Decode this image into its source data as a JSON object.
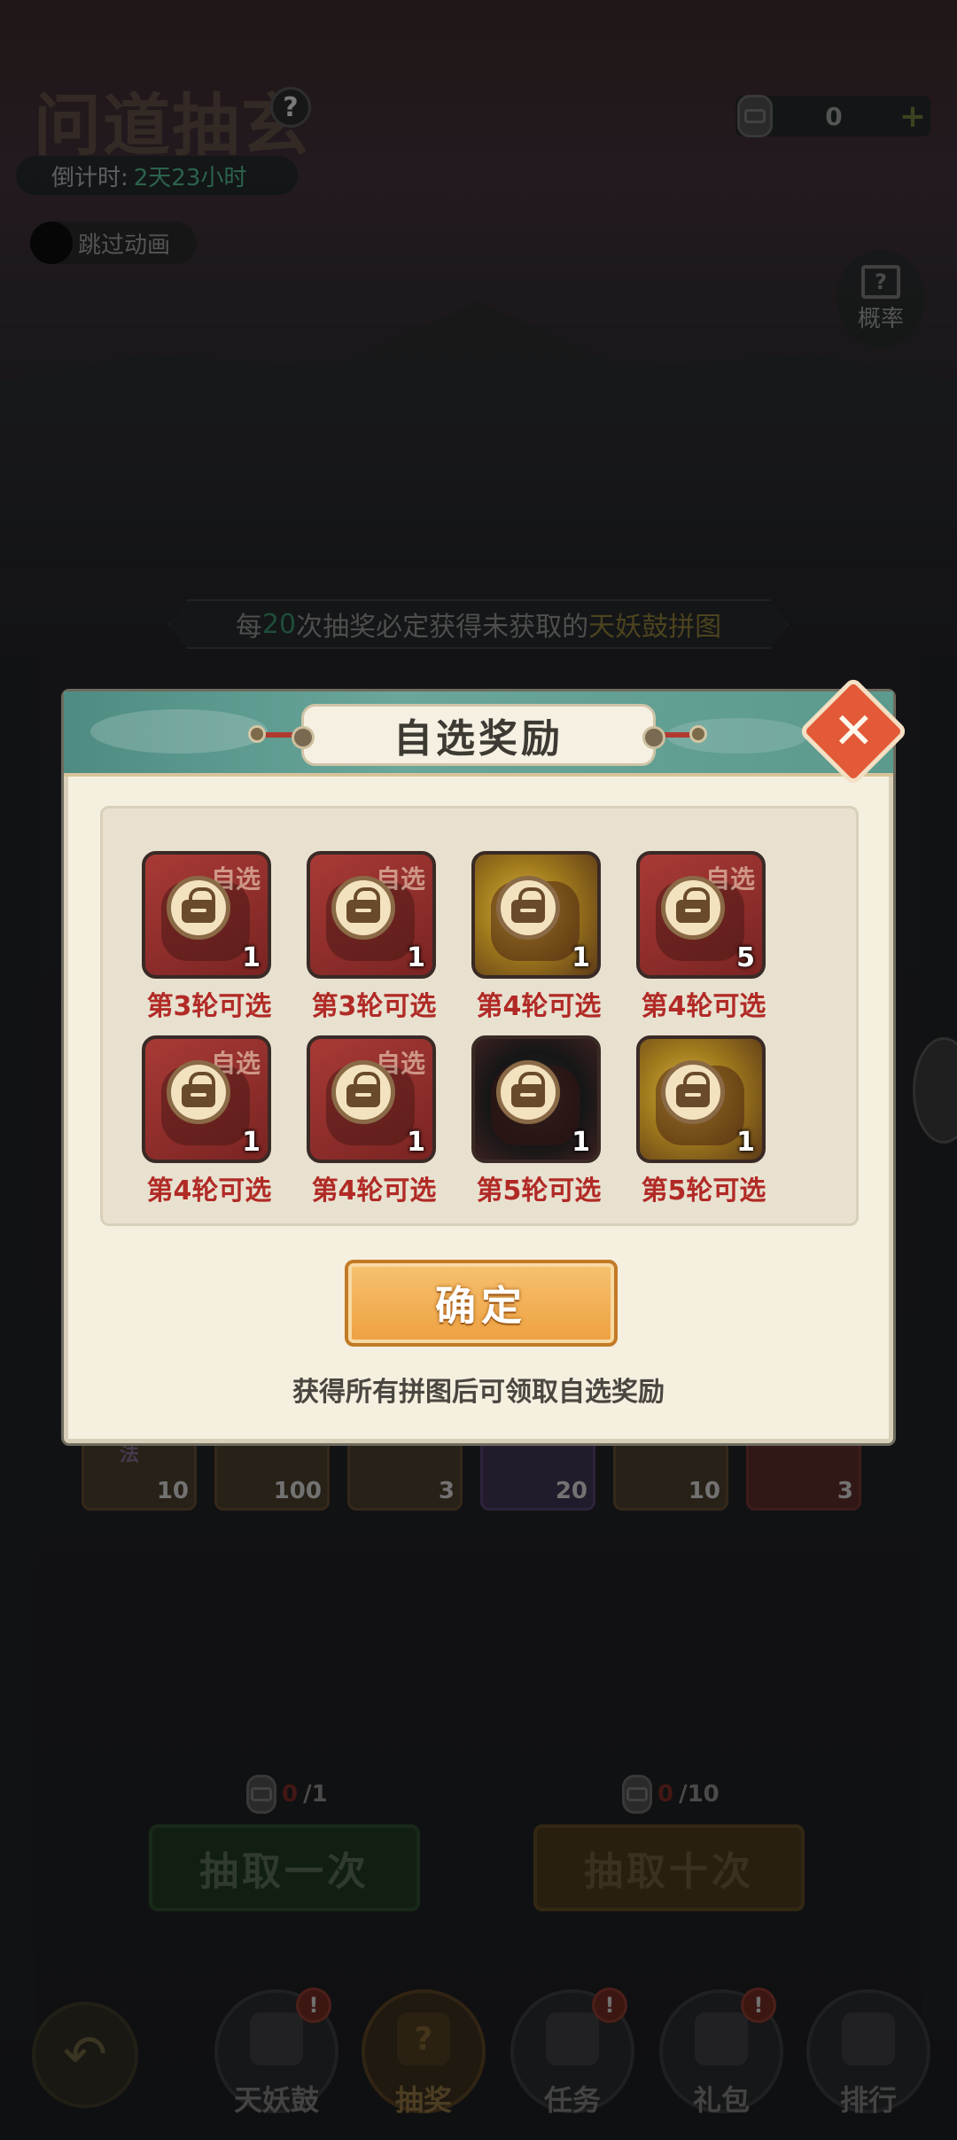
{
  "hud": {
    "title": "问道抽玄",
    "help_glyph": "?",
    "countdown_label": "倒计时:",
    "countdown_value": "2天23小时",
    "skip_label": "跳过动画",
    "currency_amount": "0",
    "currency_plus": "+",
    "prob_glyph": "?",
    "prob_label": "概率"
  },
  "banner": {
    "prefix": "每",
    "count": "20",
    "middle": "次抽奖必定获得未获取的",
    "item": "天妖鼓拼图"
  },
  "strip": [
    {
      "tag": "法",
      "qty": "10",
      "style": "brown"
    },
    {
      "tag": "",
      "qty": "100",
      "style": "brown"
    },
    {
      "tag": "",
      "qty": "3",
      "style": "brown"
    },
    {
      "tag": "",
      "qty": "20",
      "style": "purple"
    },
    {
      "tag": "",
      "qty": "10",
      "style": "brown"
    },
    {
      "tag": "",
      "qty": "3",
      "style": "red"
    }
  ],
  "draw": {
    "once_label": "抽取一次",
    "once_cost_current": "0",
    "once_cost_total": "/1",
    "ten_label": "抽取十次",
    "ten_cost_current": "0",
    "ten_cost_total": "/10"
  },
  "nav": {
    "items": [
      {
        "label": "天妖鼓",
        "icon": "drum-icon",
        "badge": "!"
      },
      {
        "label": "抽奖",
        "icon": "lottery-card-icon",
        "glyph": "?"
      },
      {
        "label": "任务",
        "icon": "scroll-task-icon",
        "badge": "!"
      },
      {
        "label": "礼包",
        "icon": "gift-chest-icon",
        "badge": "!"
      },
      {
        "label": "排行",
        "icon": "ranking-icon"
      }
    ]
  },
  "popup": {
    "title": "自选奖励",
    "close_glyph": "✕",
    "stamp": "自选",
    "rewards": [
      {
        "qty": "1",
        "condition": "第3轮可选",
        "art": "red"
      },
      {
        "qty": "1",
        "condition": "第3轮可选",
        "art": "red"
      },
      {
        "qty": "1",
        "condition": "第4轮可选",
        "art": "gold"
      },
      {
        "qty": "5",
        "condition": "第4轮可选",
        "art": "red"
      },
      {
        "qty": "1",
        "condition": "第4轮可选",
        "art": "red"
      },
      {
        "qty": "1",
        "condition": "第4轮可选",
        "art": "red"
      },
      {
        "qty": "1",
        "condition": "第5轮可选",
        "art": "dark"
      },
      {
        "qty": "1",
        "condition": "第5轮可选",
        "art": "gold"
      }
    ],
    "confirm_label": "确定",
    "hint": "获得所有拼图后可领取自选奖励"
  }
}
